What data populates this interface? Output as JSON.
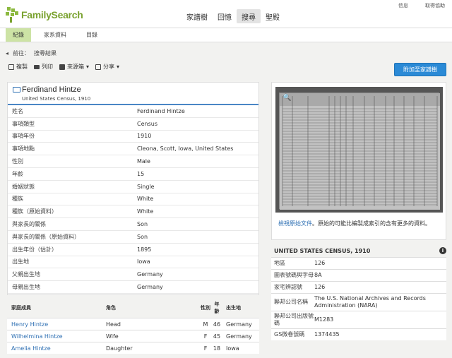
{
  "logo": {
    "text": "FamilySearch"
  },
  "util_links": [
    "信息",
    "取得協助"
  ],
  "main_nav": [
    {
      "label": "家譜樹",
      "active": false
    },
    {
      "label": "回憶",
      "active": false
    },
    {
      "label": "搜尋",
      "active": true
    },
    {
      "label": "聖殿",
      "active": false
    }
  ],
  "sub_nav": [
    {
      "label": "紀錄",
      "active": true
    },
    {
      "label": "家系資料",
      "active": false
    },
    {
      "label": "目錄",
      "active": false
    }
  ],
  "breadcrumb": {
    "prefix": "前往：",
    "link": "搜尋結果"
  },
  "toolbar": {
    "copy": "複製",
    "print": "列印",
    "source_box": "來源箱",
    "share": "分享"
  },
  "attach_button": "附加至家譜樹",
  "record": {
    "name": "Ferdinand Hintze",
    "collection": "United States Census, 1910",
    "rows": [
      {
        "k": "姓名",
        "v": "Ferdinand Hintze"
      },
      {
        "k": "事項類型",
        "v": "Census"
      },
      {
        "k": "事項年份",
        "v": "1910"
      },
      {
        "k": "事項地點",
        "v": "Cleona, Scott, Iowa, United States"
      },
      {
        "k": "性別",
        "v": "Male"
      },
      {
        "k": "年齡",
        "v": "15"
      },
      {
        "k": "婚姻狀態",
        "v": "Single"
      },
      {
        "k": "種族",
        "v": "White"
      },
      {
        "k": "種族（原始資料）",
        "v": "White"
      },
      {
        "k": "與家長的關係",
        "v": "Son"
      },
      {
        "k": "與家長的關係（原始資料）",
        "v": "Son"
      },
      {
        "k": "出生年份（估計）",
        "v": "1895"
      },
      {
        "k": "出生地",
        "v": "Iowa"
      },
      {
        "k": "父親出生地",
        "v": "Germany"
      },
      {
        "k": "母親出生地",
        "v": "Germany"
      }
    ]
  },
  "family": {
    "headers": {
      "member": "家庭成員",
      "role": "角色",
      "gender": "性別",
      "age": "年齡",
      "birthplace": "出生地"
    },
    "rows": [
      {
        "name": "Henry Hintze",
        "role": "Head",
        "gender": "M",
        "age": "46",
        "birthplace": "Germany"
      },
      {
        "name": "Wilhelmina Hintze",
        "role": "Wife",
        "gender": "F",
        "age": "45",
        "birthplace": "Germany"
      },
      {
        "name": "Amelia Hintze",
        "role": "Daughter",
        "gender": "F",
        "age": "18",
        "birthplace": "Iowa"
      }
    ]
  },
  "image_card": {
    "view_link": "檢視原始文件",
    "caption_rest": "。原始的可能比編製成索引的含有更多的資料。"
  },
  "source": {
    "title": "UNITED STATES CENSUS, 1910",
    "rows": [
      {
        "k": "地區",
        "v": "126",
        "link": false
      },
      {
        "k": "圖表號碼與字母",
        "v": "8A",
        "link": false
      },
      {
        "k": "家宅辨認號",
        "v": "126",
        "link": false
      },
      {
        "k": "聯邦公司名稱",
        "v": "The U.S. National Archives and Records Administration (NARA)",
        "link": false
      },
      {
        "k": "聯邦公司出版號碼",
        "v": "M1283",
        "link": false
      },
      {
        "k": "GS微卷號碼",
        "v": "1374435",
        "link": true
      }
    ]
  },
  "colors": {
    "accent": "#8cb93f",
    "link": "#2d6fb3",
    "button": "#2b8ad6"
  }
}
